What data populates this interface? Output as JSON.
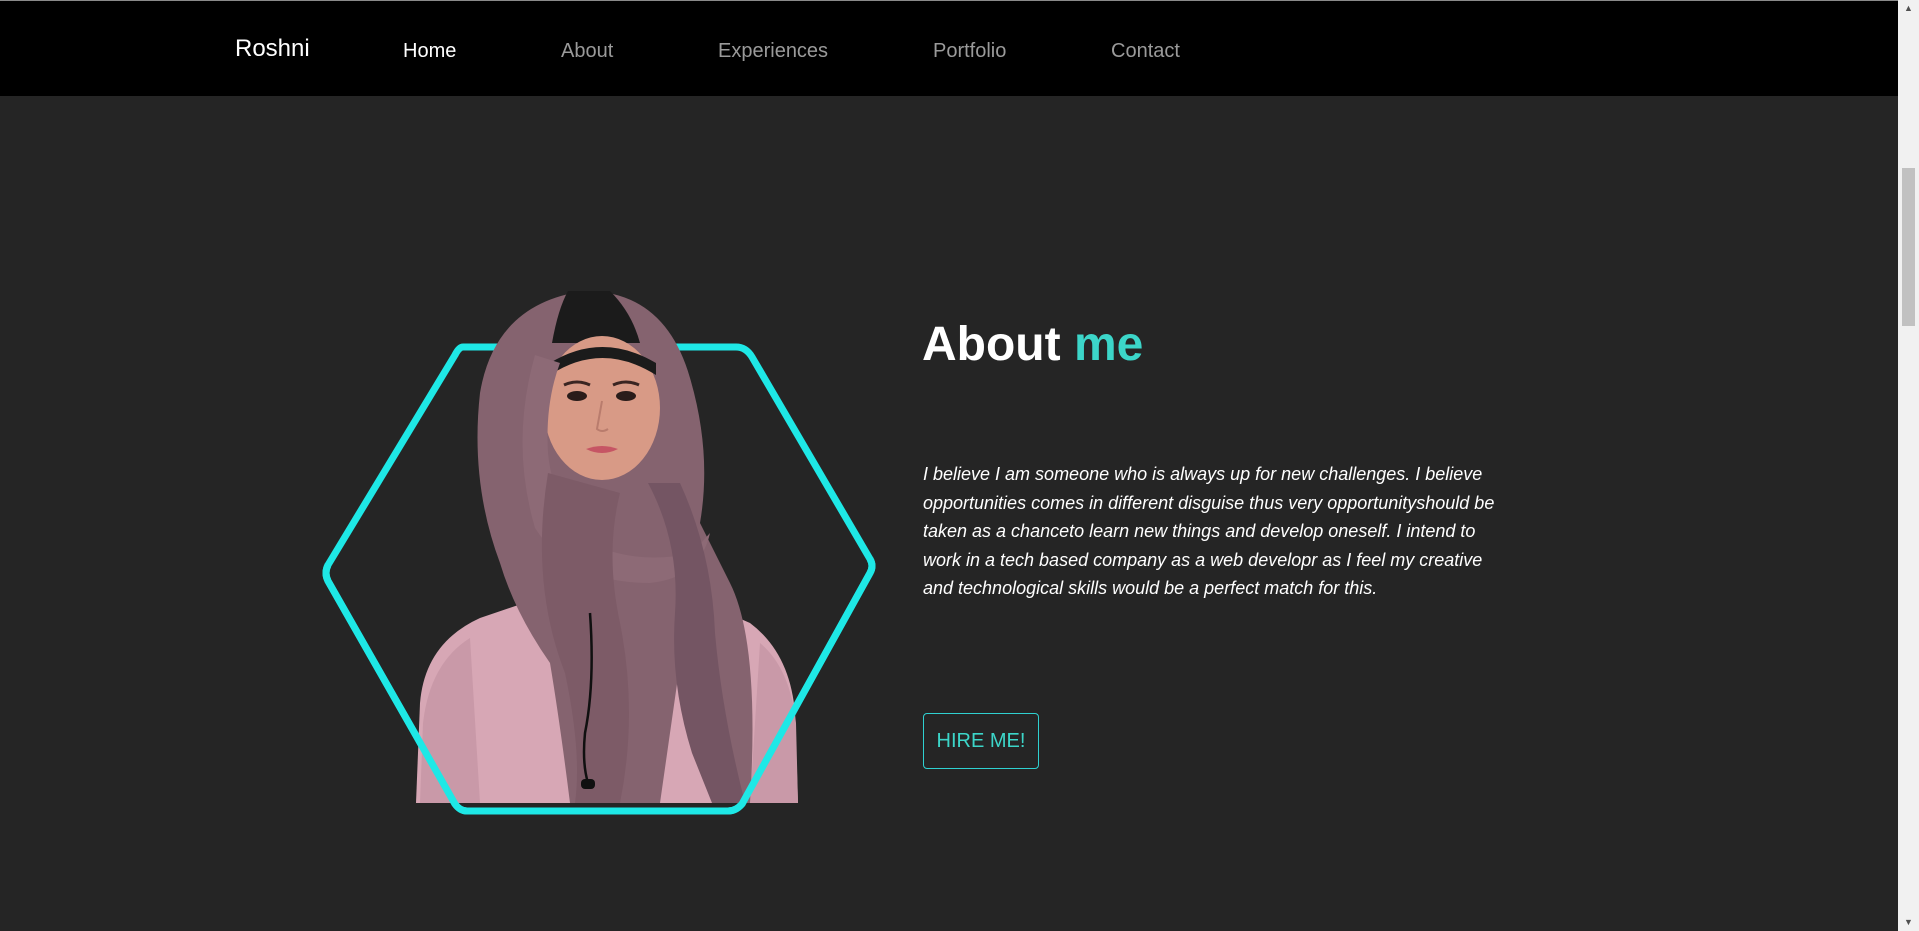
{
  "nav": {
    "brand": "Roshni",
    "items": [
      {
        "label": "Home",
        "active": true
      },
      {
        "label": "About",
        "active": false
      },
      {
        "label": "Experiences",
        "active": false
      },
      {
        "label": "Portfolio",
        "active": false
      },
      {
        "label": "Contact",
        "active": false
      }
    ]
  },
  "about": {
    "title_main": "About",
    "title_accent": "me",
    "paragraph": "I believe I am someone who is always up for new challenges. I believe opportunities comes in different disguise thus very opportunityshould be taken as a chanceto learn new things and develop oneself. I intend to work in a tech based company as a web developr as I feel my creative and technological skills would be a perfect match for this.",
    "button_label": "HIRE ME!"
  },
  "colors": {
    "background": "#252525",
    "navbar": "#000000",
    "accent": "#3cd6c9",
    "hex_border": "#1ee8e6"
  },
  "icons": {
    "scroll_up": "scroll-up-arrow-icon",
    "scroll_down": "scroll-down-arrow-icon"
  }
}
